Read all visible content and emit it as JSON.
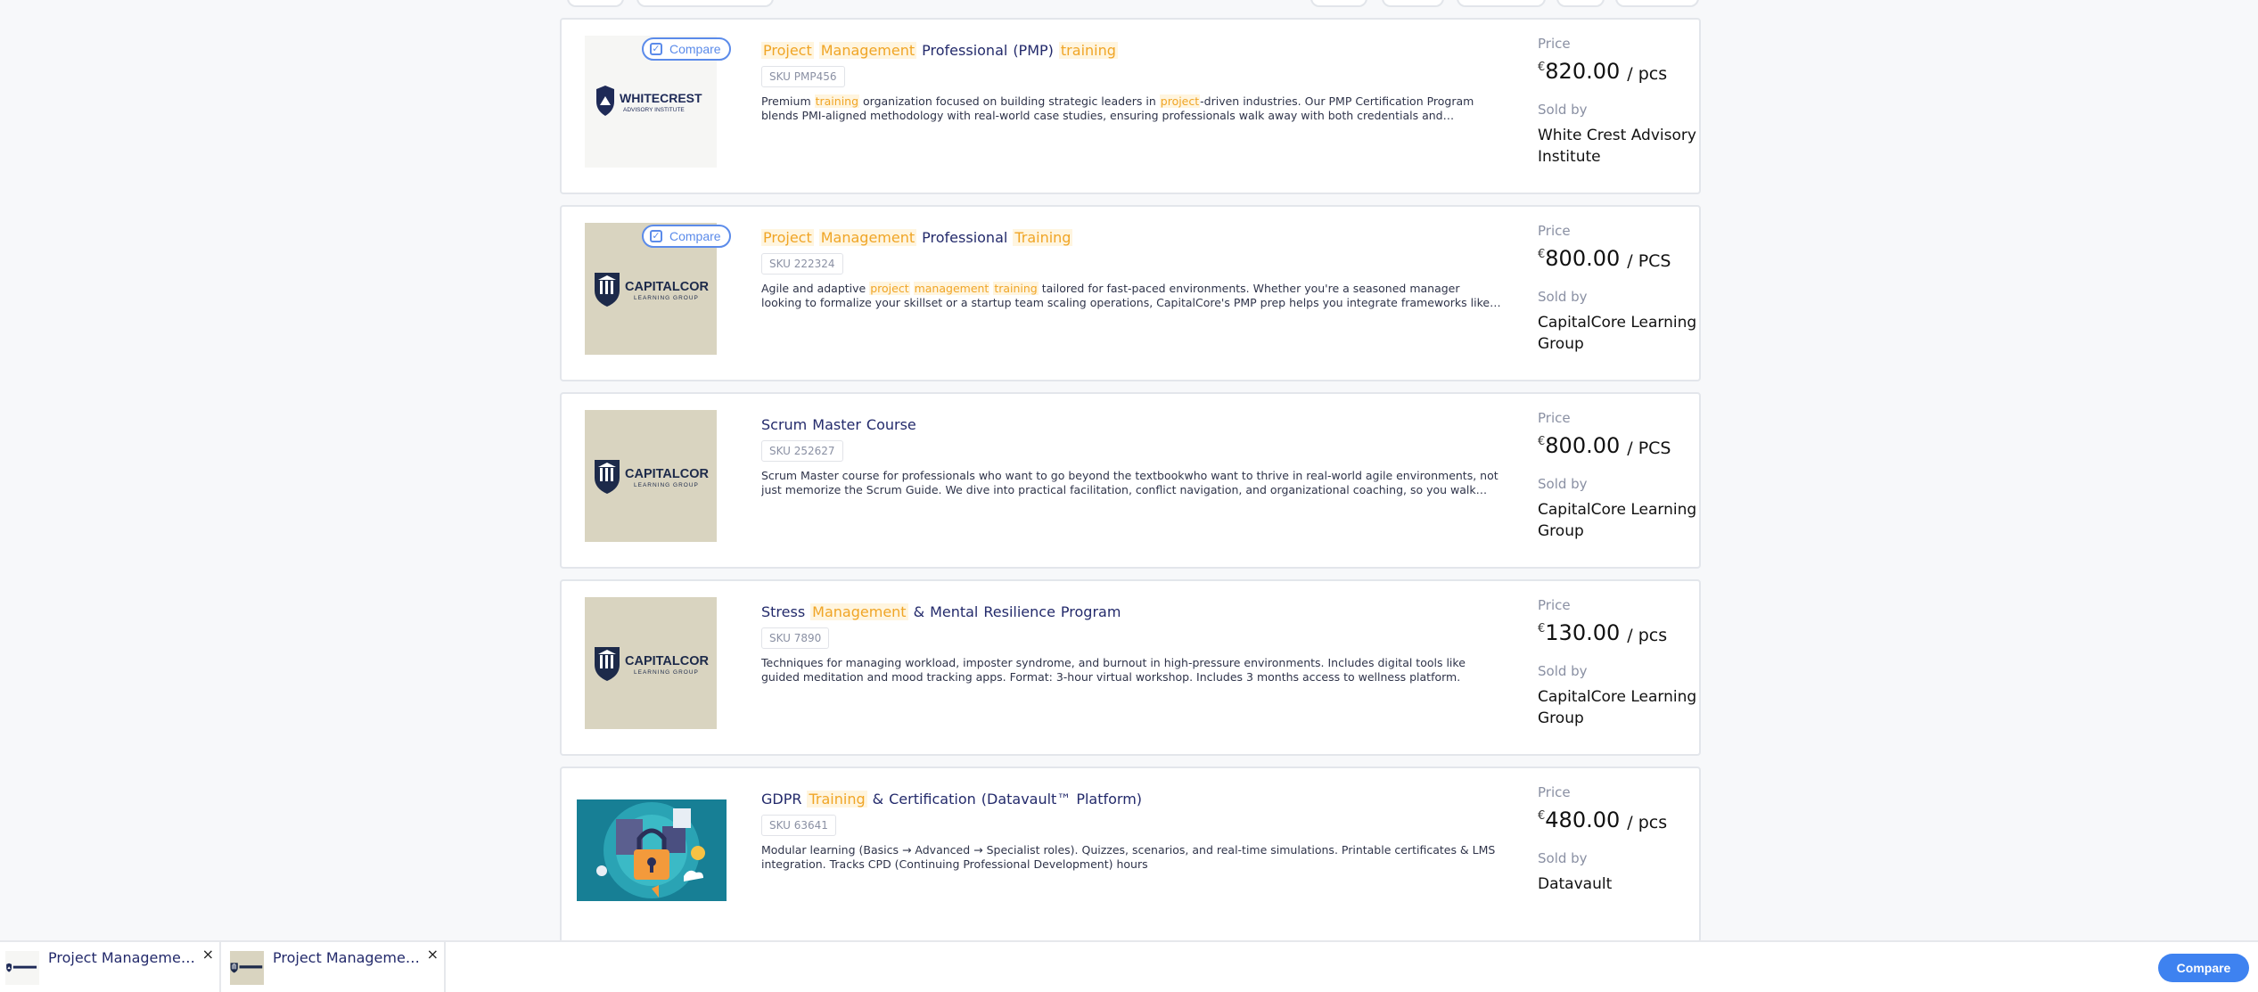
{
  "products": [
    {
      "title_words": [
        {
          "text": "Project",
          "hl": true
        },
        {
          "text": "Management",
          "hl": true
        },
        {
          "text": "Professional",
          "hl": false
        },
        {
          "text": "(PMP)",
          "hl": false
        },
        {
          "text": "training",
          "hl": true
        }
      ],
      "sku": "SKU PMP456",
      "desc_parts": [
        {
          "text": "Premium ",
          "hl": false
        },
        {
          "text": "training",
          "hl": true
        },
        {
          "text": " organization focused on building strategic leaders in ",
          "hl": false
        },
        {
          "text": "project",
          "hl": true
        },
        {
          "text": "-driven industries. Our PMP Certification Program blends PMI-aligned methodology with real-world case studies, ensuring professionals walk away with both credentials and confidence. With a...",
          "hl": false
        }
      ],
      "price_label": "Price",
      "currency": "€",
      "amount": "820.00",
      "unit": "/ pcs",
      "sold_label": "Sold by",
      "seller": "White Crest Advisory Institute",
      "logo": {
        "type": "whitecrest",
        "name": "WHITECREST",
        "sub": "ADVISORY INSTITUTE"
      },
      "compare_label": "Compare",
      "compare_checked": true
    },
    {
      "title_words": [
        {
          "text": "Project",
          "hl": true
        },
        {
          "text": "Management",
          "hl": true
        },
        {
          "text": "Professional",
          "hl": false
        },
        {
          "text": "Training",
          "hl": true
        }
      ],
      "sku": "SKU 222324",
      "desc_parts": [
        {
          "text": "Agile and adaptive ",
          "hl": false
        },
        {
          "text": "project",
          "hl": true
        },
        {
          "text": " ",
          "hl": false
        },
        {
          "text": "management",
          "hl": true
        },
        {
          "text": " ",
          "hl": false
        },
        {
          "text": "training",
          "hl": true
        },
        {
          "text": " tailored for fast-paced environments. Whether you're a seasoned manager looking to formalize your skillset or a startup team scaling operations, CapitalCore's PMP prep helps you integrate frameworks like Agile, Hybrid, and...",
          "hl": false
        }
      ],
      "price_label": "Price",
      "currency": "€",
      "amount": "800.00",
      "unit": "/ PCS",
      "sold_label": "Sold by",
      "seller": "CapitalCore Learning Group",
      "logo": {
        "type": "capitalcore",
        "name": "CAPITALCORE",
        "sub": "LEARNING GROUP"
      },
      "compare_label": "Compare",
      "compare_checked": true
    },
    {
      "title_words": [
        {
          "text": "Scrum",
          "hl": false
        },
        {
          "text": "Master",
          "hl": false
        },
        {
          "text": "Course",
          "hl": false
        }
      ],
      "sku": "SKU 252627",
      "desc_parts": [
        {
          "text": "Scrum Master course for professionals who want to go beyond the textbookwho want to thrive in real-world agile environments, not just memorize the Scrum Guide. We dive into practical facilitation, conflict navigation, and organizational coaching, so you walk away not just...",
          "hl": false
        }
      ],
      "price_label": "Price",
      "currency": "€",
      "amount": "800.00",
      "unit": "/ PCS",
      "sold_label": "Sold by",
      "seller": "CapitalCore Learning Group",
      "logo": {
        "type": "capitalcore",
        "name": "CAPITALCORE",
        "sub": "LEARNING GROUP"
      },
      "compare_label": "",
      "compare_checked": false
    },
    {
      "title_words": [
        {
          "text": "Stress",
          "hl": false
        },
        {
          "text": "Management",
          "hl": true
        },
        {
          "text": "&",
          "hl": false
        },
        {
          "text": "Mental",
          "hl": false
        },
        {
          "text": "Resilience",
          "hl": false
        },
        {
          "text": "Program",
          "hl": false
        }
      ],
      "sku": "SKU 7890",
      "desc_parts": [
        {
          "text": "Techniques for managing workload, imposter syndrome, and burnout in high-pressure environments. Includes digital tools like guided meditation and mood tracking apps. Format: 3-hour virtual workshop. Includes 3 months access to wellness platform.",
          "hl": false
        }
      ],
      "price_label": "Price",
      "currency": "€",
      "amount": "130.00",
      "unit": "/ pcs",
      "sold_label": "Sold by",
      "seller": "CapitalCore Learning Group",
      "logo": {
        "type": "capitalcore",
        "name": "CAPITALCORE",
        "sub": "LEARNING GROUP"
      },
      "compare_label": "",
      "compare_checked": false
    },
    {
      "title_words": [
        {
          "text": "GDPR",
          "hl": false
        },
        {
          "text": "Training",
          "hl": true
        },
        {
          "text": "&",
          "hl": false
        },
        {
          "text": "Certification",
          "hl": false
        },
        {
          "text": "(Datavault™",
          "hl": false
        },
        {
          "text": "Platform)",
          "hl": false
        }
      ],
      "sku": "SKU 63641",
      "desc_parts": [
        {
          "text": "Modular learning (Basics → Advanced → Specialist roles). Quizzes, scenarios, and real-time simulations. Printable certificates & LMS integration. Tracks CPD (Continuing Professional Development) hours",
          "hl": false
        }
      ],
      "price_label": "Price",
      "currency": "€",
      "amount": "480.00",
      "unit": "/ pcs",
      "sold_label": "Sold by",
      "seller": "Datavault",
      "logo": {
        "type": "gdpr"
      },
      "compare_label": "",
      "compare_checked": false
    }
  ],
  "compare_tray": {
    "items": [
      {
        "name": "Project Management...",
        "logo": "whitecrest",
        "close": "×"
      },
      {
        "name": "Project Management...",
        "logo": "capitalcore",
        "close": "×"
      }
    ],
    "button_label": "Compare"
  },
  "colors": {
    "accent": "#3e82f0",
    "highlight": "#f0a526",
    "title": "#232a6b",
    "whitecrest_logo": "#1e2a57",
    "capitalcore_logo": "#1d2a4a",
    "capitalcore_bg": "#d9d4c0"
  }
}
